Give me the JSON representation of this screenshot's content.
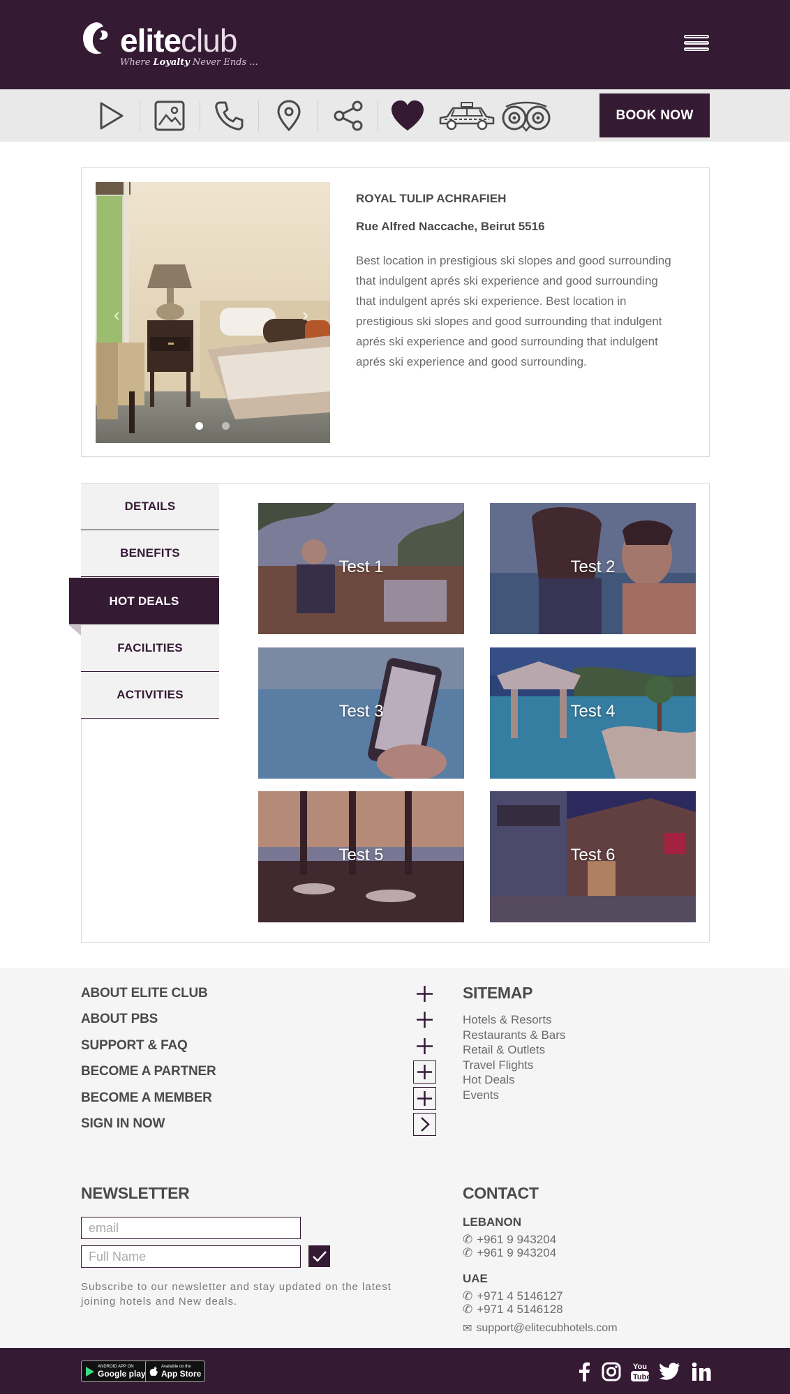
{
  "brand": {
    "name_bold": "elite",
    "name_light": "club",
    "tagline_pre": "Where ",
    "tagline_bold": "Loyalty",
    "tagline_post": " Never Ends ..."
  },
  "toolbar": {
    "icons": [
      "play-icon",
      "gallery-icon",
      "phone-icon",
      "location-pin-icon",
      "share-icon",
      "heart-icon",
      "taxi-icon",
      "tripadvisor-icon"
    ],
    "book_label": "BOOK NOW"
  },
  "hotel": {
    "name": "ROYAL TULIP ACHRAFIEH",
    "address": "Rue Alfred Naccache, Beirut 5516",
    "description": "Best location in prestigious ski slopes and good surrounding that indulgent aprés ski experience and good surrounding that indulgent aprés ski experience. Best location in prestigious ski slopes and good surrounding that indulgent aprés ski experience and good surrounding that indulgent aprés ski experience and good surrounding."
  },
  "tabs": [
    {
      "label": "DETAILS"
    },
    {
      "label": "BENEFITS"
    },
    {
      "label": "HOT DEALS"
    },
    {
      "label": "FACILITIES"
    },
    {
      "label": "ACTIVITIES"
    }
  ],
  "active_tab": "HOT DEALS",
  "deals": [
    {
      "label": "Test 1"
    },
    {
      "label": "Test 2"
    },
    {
      "label": "Test 3"
    },
    {
      "label": "Test 4"
    },
    {
      "label": "Test 5"
    },
    {
      "label": "Test 6"
    }
  ],
  "accordion": [
    {
      "label": "ABOUT ELITE CLUB",
      "icon": "plus-icon"
    },
    {
      "label": "ABOUT PBS",
      "icon": "plus-icon"
    },
    {
      "label": "SUPPORT & FAQ",
      "icon": "plus-icon"
    },
    {
      "label": "BECOME A PARTNER",
      "icon": "plus-boxed-icon"
    },
    {
      "label": "BECOME A MEMBER",
      "icon": "plus-boxed-icon"
    },
    {
      "label": "SIGN IN NOW",
      "icon": "chevron-right-boxed-icon"
    }
  ],
  "sitemap": {
    "title": "SITEMAP",
    "links": [
      "Hotels & Resorts",
      "Restaurants & Bars",
      "Retail & Outlets",
      "Travel Flights",
      "Hot Deals",
      "Events"
    ]
  },
  "newsletter": {
    "title": "NEWSLETTER",
    "email_placeholder": "email",
    "name_placeholder": "Full Name",
    "note": "Subscribe to our newsletter and stay updated on the latest joining hotels and New deals."
  },
  "contact": {
    "title": "CONTACT",
    "lebanon_label": "LEBANON",
    "lebanon_phones": [
      "+961 9 943204",
      "+961 9 943204"
    ],
    "uae_label": "UAE",
    "uae_phones": [
      "+971 4 5146127",
      "+971 4 5146128"
    ],
    "email": "support@elitecubhotels.com"
  },
  "apps": {
    "google_small": "ANDROID APP ON",
    "google_big": "Google play",
    "apple_small": "Available on the",
    "apple_big": "App Store"
  },
  "social": [
    "facebook-icon",
    "instagram-icon",
    "youtube-icon",
    "twitter-icon",
    "linkedin-icon"
  ],
  "colors": {
    "brand_purple": "#351a34",
    "toolbar_bg": "#e9e9e9",
    "footer_bg": "#f5f5f5"
  }
}
